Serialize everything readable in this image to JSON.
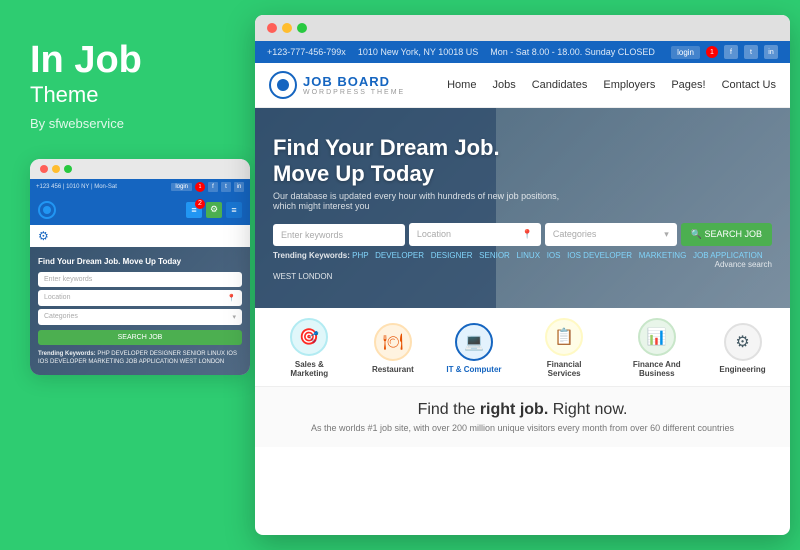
{
  "brand": {
    "title": "In Job",
    "subtitle": "Theme",
    "by": "By sfwebservice"
  },
  "topbar": {
    "phone": "+123-777-456-799x",
    "address": "1010 New York, NY 10018 US",
    "hours": "Mon - Sat 8.00 - 18.00. Sunday CLOSED",
    "login": "login",
    "notif_count": "1"
  },
  "nav": {
    "logo_text": "JOB BOARD",
    "logo_sub": "WORDPRESS THEME",
    "links": [
      "Home",
      "Jobs",
      "Candidates",
      "Employers",
      "Pages!",
      "Contact Us"
    ]
  },
  "hero": {
    "title": "Find Your Dream Job. Move Up Today",
    "subtitle": "Our database is updated every hour with hundreds of new job positions, which might interest you",
    "search_placeholder": "Enter keywords",
    "location_placeholder": "Location",
    "categories_placeholder": "Categories",
    "search_btn": "SEARCH JOB",
    "trending_label": "Trending Keywords:",
    "keywords": [
      "PHP",
      "DEVELOPER",
      "DESIGNER",
      "SENIOR",
      "LINUX",
      "IOS",
      "IOS DEVELOPER",
      "MARKETING",
      "JOB APPLICATION",
      "WEST LONDON"
    ],
    "advance_link": "Advance search"
  },
  "categories": [
    {
      "label": "Sales & Marketing",
      "icon": "🎯",
      "color": "teal"
    },
    {
      "label": "Restaurant",
      "icon": "🍽",
      "color": "orange"
    },
    {
      "label": "IT & Computer",
      "icon": "💻",
      "color": "blue",
      "selected": true
    },
    {
      "label": "Financial Services",
      "icon": "📋",
      "color": "yellow"
    },
    {
      "label": "Finance And Business",
      "icon": "📊",
      "color": "green"
    },
    {
      "label": "Engineering",
      "icon": "⚙",
      "color": "gray"
    }
  ],
  "bottom": {
    "title_part1": "Find the ",
    "title_highlight": "right job.",
    "title_part2": " Right now.",
    "subtitle": "As the worlds #1 job site, with over 200 million unique visitors every month from over 60 different countries"
  },
  "mini": {
    "search_placeholder": "Enter keywords",
    "location_placeholder": "Location",
    "categories_placeholder": "Categories",
    "search_btn": "SEARCH JOB",
    "trending_label": "Trending Keywords:",
    "keywords": "PHP  DEVELOPER  DESIGNER  SENIOR  LINUX  IOS  IOS DEVELOPER  MARKETING  JOB APPLICATION  WEST LONDON"
  }
}
